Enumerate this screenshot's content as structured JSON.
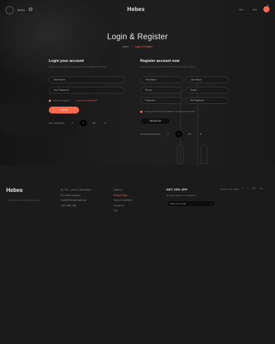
{
  "header": {
    "menu_label": "MENU",
    "brand": "Hebes",
    "currency": "USD",
    "language": "ENG",
    "cart_count": "0"
  },
  "page": {
    "title": "Login & Register",
    "breadcrumb": [
      "Home",
      "Login & Register"
    ]
  },
  "login": {
    "title": "Login your account",
    "subtitle": "Login to your account to discovery all great features in this item",
    "username_placeholder": "User Name",
    "password_placeholder": "Your Password",
    "keep_label": "Keep me logged in",
    "forgot_label": "Forgot your password?",
    "button": "LOGIN",
    "social_label": "OR LOGIN WITH"
  },
  "register": {
    "title": "Register account now",
    "subtitle": "Personal your Lorem is most for the best services in note of",
    "first_name": "First Name",
    "last_name": "Last Name",
    "phone": "Phone",
    "email": "Email",
    "password": "Password",
    "re_password": "Re-Password",
    "terms_label": "I Accept the terms and conditions, including the Privacy",
    "button": "REGISTER",
    "social_label": "OR REGISTER WITH"
  },
  "social_icons": [
    "f",
    "t",
    "G+",
    "o"
  ],
  "footer": {
    "brand": "Hebes",
    "copyright": "© 2017 Hebes . All Rights Reserved",
    "address_lines": [
      "No. 342 - London Oxford Street",
      "012 United Kingdom",
      "Email@hebes@email.com",
      "+032 3456 7890"
    ],
    "links": [
      "About Us",
      "Privacy Policy",
      "Terms & Conditions",
      "Contact Us",
      "Faq"
    ],
    "newsletter_title": "GET 20% OFF",
    "newsletter_sub": "By subscribing to our newsletter",
    "email_placeholder": "Enter your email",
    "follow_label": "Follow Us On Social:",
    "social_icons": [
      "t",
      "f",
      "G+",
      "in"
    ]
  },
  "colors": {
    "accent": "#ff6a4d",
    "background": "#1b1b1b"
  }
}
